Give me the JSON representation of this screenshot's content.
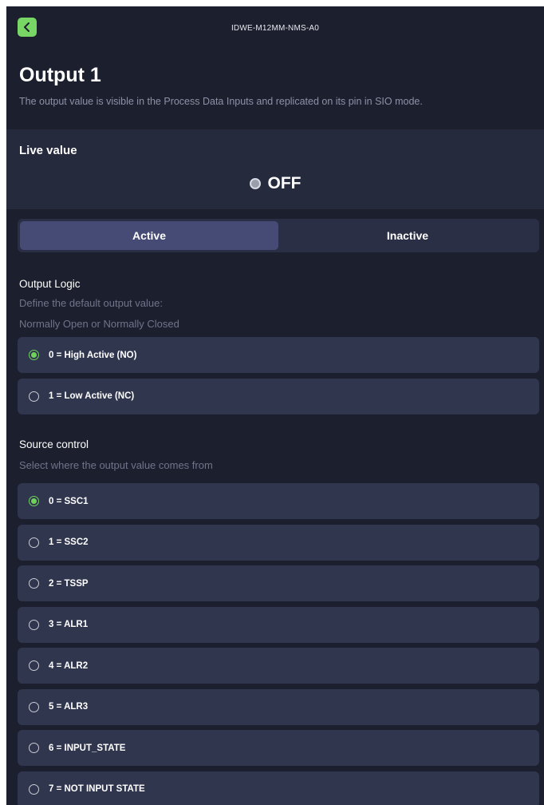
{
  "header": {
    "device_name": "IDWE-M12MM-NMS-A0",
    "back_icon": "chevron-left-icon",
    "accent_color": "#78d764"
  },
  "page": {
    "title": "Output 1",
    "description": "The output value is visible in the Process Data Inputs and replicated on its pin in SIO mode."
  },
  "live": {
    "label": "Live value",
    "state": "OFF"
  },
  "tabs": [
    {
      "label": "Active",
      "selected": true
    },
    {
      "label": "Inactive",
      "selected": false
    }
  ],
  "output_logic": {
    "title": "Output Logic",
    "desc_line1": "Define the default output value:",
    "desc_line2": "Normally Open or Normally Closed",
    "options": [
      {
        "label": "0 = High Active (NO)",
        "selected": true
      },
      {
        "label": "1 = Low Active (NC)",
        "selected": false
      }
    ]
  },
  "source_control": {
    "title": "Source control",
    "desc": "Select where the output value comes from",
    "options": [
      {
        "label": "0 = SSC1",
        "selected": true
      },
      {
        "label": "1 = SSC2",
        "selected": false
      },
      {
        "label": "2 = TSSP",
        "selected": false
      },
      {
        "label": "3 = ALR1",
        "selected": false
      },
      {
        "label": "4 = ALR2",
        "selected": false
      },
      {
        "label": "5 = ALR3",
        "selected": false
      },
      {
        "label": "6 = INPUT_STATE",
        "selected": false
      },
      {
        "label": "7 = NOT INPUT STATE",
        "selected": false
      }
    ]
  }
}
